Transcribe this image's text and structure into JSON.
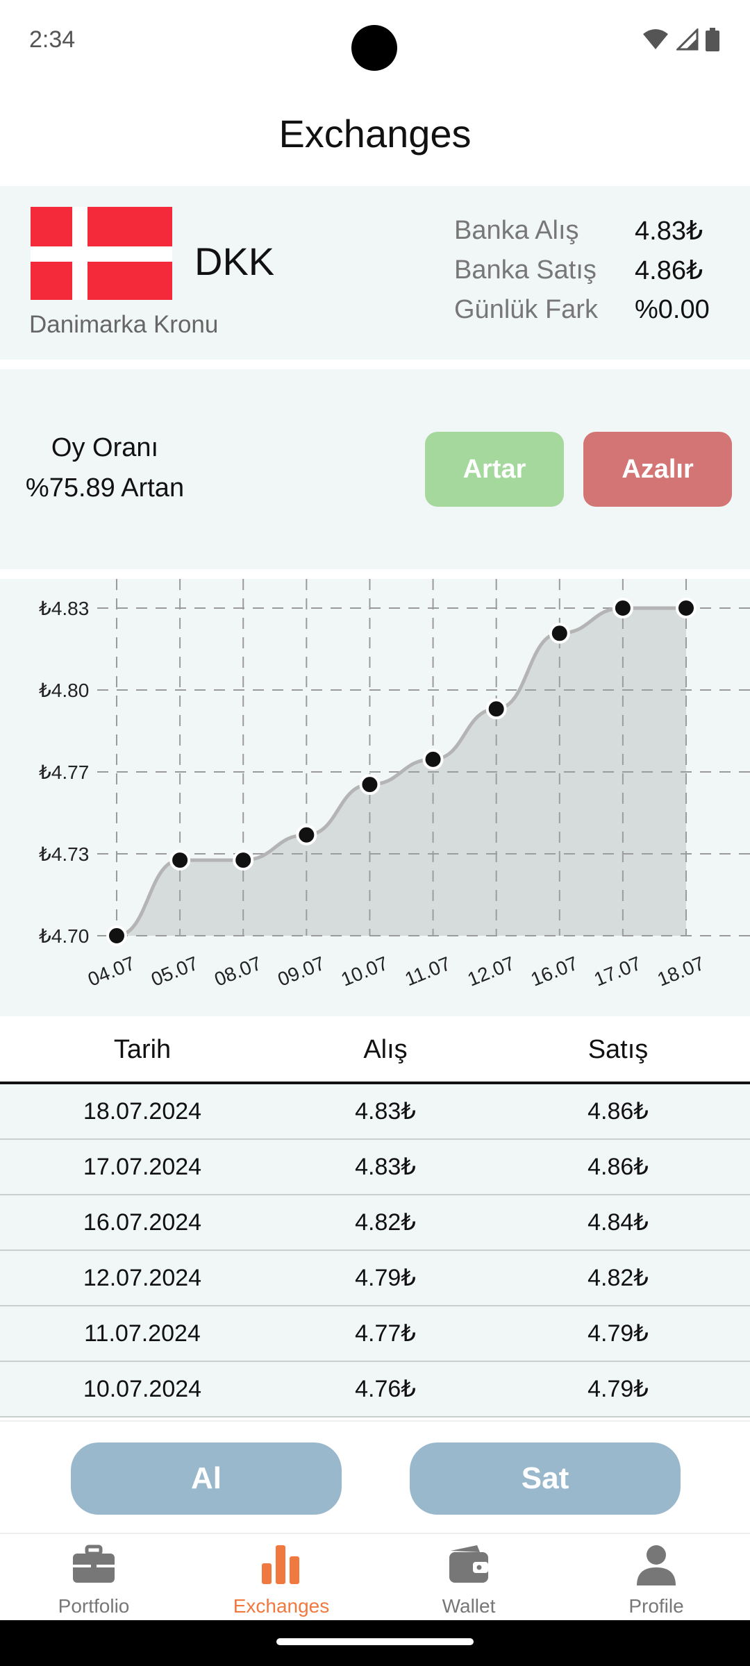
{
  "status": {
    "time": "2:34"
  },
  "header": {
    "title": "Exchanges"
  },
  "currency": {
    "code": "DKK",
    "name": "Danimarka Kronu",
    "rates": [
      {
        "label": "Banka Alış",
        "value": "4.83₺"
      },
      {
        "label": "Banka Satış",
        "value": "4.86₺"
      },
      {
        "label": "Günlük Fark",
        "value": "%0.00"
      }
    ]
  },
  "vote": {
    "title": "Oy Oranı",
    "value": "%75.89 Artan",
    "up_label": "Artar",
    "down_label": "Azalır"
  },
  "chart_data": {
    "type": "area",
    "x": [
      "04.07",
      "05.07",
      "08.07",
      "09.07",
      "10.07",
      "11.07",
      "12.07",
      "16.07",
      "17.07",
      "18.07"
    ],
    "values": [
      4.7,
      4.73,
      4.73,
      4.74,
      4.76,
      4.77,
      4.79,
      4.82,
      4.83,
      4.83
    ],
    "y_ticks": [
      "₺4.70",
      "₺4.73",
      "₺4.77",
      "₺4.80",
      "₺4.83"
    ],
    "ylim": [
      4.7,
      4.83
    ],
    "grid": true
  },
  "table": {
    "headers": [
      "Tarih",
      "Alış",
      "Satış"
    ],
    "rows": [
      [
        "18.07.2024",
        "4.83₺",
        "4.86₺"
      ],
      [
        "17.07.2024",
        "4.83₺",
        "4.86₺"
      ],
      [
        "16.07.2024",
        "4.82₺",
        "4.84₺"
      ],
      [
        "12.07.2024",
        "4.79₺",
        "4.82₺"
      ],
      [
        "11.07.2024",
        "4.77₺",
        "4.79₺"
      ],
      [
        "10.07.2024",
        "4.76₺",
        "4.79₺"
      ]
    ]
  },
  "actions": {
    "buy_label": "Al",
    "sell_label": "Sat"
  },
  "nav": {
    "items": [
      {
        "label": "Portfolio",
        "icon": "briefcase-icon"
      },
      {
        "label": "Exchanges",
        "icon": "bar-chart-icon"
      },
      {
        "label": "Wallet",
        "icon": "wallet-icon"
      },
      {
        "label": "Profile",
        "icon": "person-icon"
      }
    ],
    "active": "Exchanges"
  },
  "colors": {
    "accent": "#f0793f",
    "up_button": "#a4d89c",
    "down_button": "#d37575",
    "action_button": "#9ab8cc",
    "panel_bg": "#f1f6f6"
  }
}
